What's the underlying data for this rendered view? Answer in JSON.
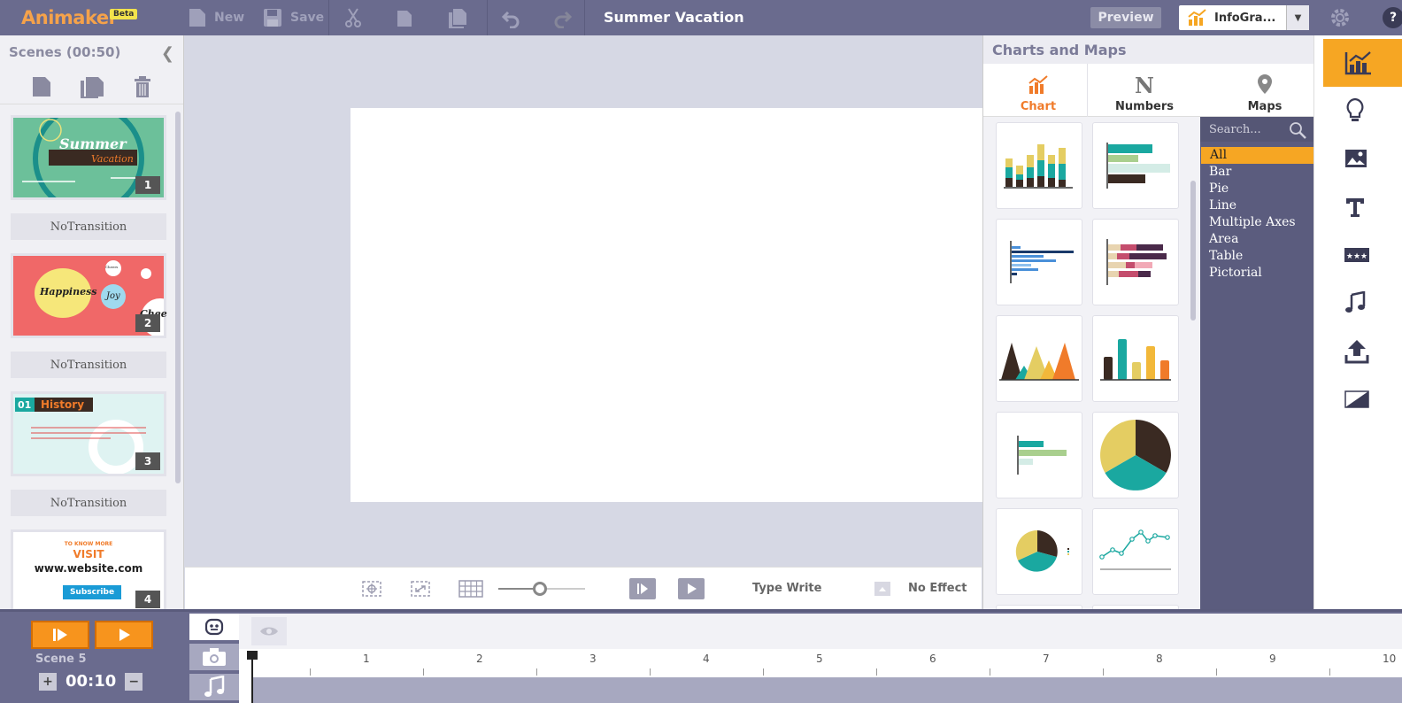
{
  "app": {
    "name": "Animaker",
    "badge": "Beta"
  },
  "toolbar": {
    "new_label": "New",
    "save_label": "Save",
    "preview_label": "Preview"
  },
  "document": {
    "title": "Summer Vacation"
  },
  "template_select": {
    "value": "InfoGra..."
  },
  "scenes_panel": {
    "title": "Scenes (00:50)",
    "scenes": [
      {
        "number": "1",
        "thumb_title": "Summer",
        "thumb_subtitle": "Vacation",
        "transition": "NoTransition"
      },
      {
        "number": "2",
        "thumb_words": [
          "Happiness",
          "Joy",
          "Chee",
          "Cheers"
        ],
        "transition": "NoTransition"
      },
      {
        "number": "3",
        "thumb_title": "History",
        "thumb_index": "01",
        "transition": "NoTransition"
      },
      {
        "number": "4",
        "thumb_top": "TO KNOW MORE",
        "thumb_visit": "VISIT",
        "thumb_url": "www.website.com",
        "thumb_btn": "Subscribe"
      }
    ]
  },
  "stage_toolbar": {
    "effect_label": "Type Write",
    "no_effect_label": "No Effect",
    "zoom_percent": 50
  },
  "charts_panel": {
    "title": "Charts and Maps",
    "tabs": [
      {
        "label": "Chart",
        "active": true
      },
      {
        "label": "Numbers",
        "active": false
      },
      {
        "label": "Maps",
        "active": false
      }
    ],
    "search_placeholder": "Search...",
    "categories": [
      "All",
      "Bar",
      "Pie",
      "Line",
      "Multiple Axes",
      "Area",
      "Table",
      "Pictorial"
    ],
    "selected_category": "All"
  },
  "timeline": {
    "scene_label": "Scene 5",
    "duration": "00:10",
    "ruler": [
      "1",
      "2",
      "3",
      "4",
      "5",
      "6",
      "7",
      "8",
      "9",
      "10"
    ]
  },
  "colors": {
    "topbar": "#6a6b8e",
    "accent_orange": "#f7941d",
    "accent_yellow": "#f6a623",
    "teal": "#1aa8a0",
    "dark_brown": "#3a2a22",
    "mustard": "#e4cd62"
  }
}
